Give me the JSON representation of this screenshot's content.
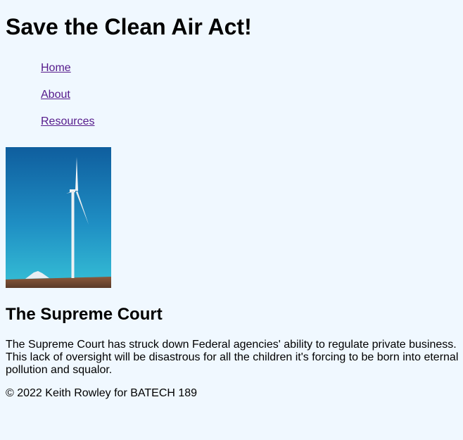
{
  "header": {
    "title": "Save the Clean Air Act!"
  },
  "nav": {
    "items": [
      {
        "label": "Home"
      },
      {
        "label": "About"
      },
      {
        "label": "Resources"
      }
    ]
  },
  "hero": {
    "subject": "wind-turbine-photo",
    "colors": {
      "sky_top": "#0f5e9e",
      "sky_bottom": "#2ab5d4",
      "ground": "#6b4a35"
    }
  },
  "main": {
    "heading": "The Supreme Court",
    "paragraph": "The Supreme Court has struck down Federal agencies' ability to regulate private business. This lack of oversight will be disastrous for all the children it's forcing to be born into eternal pollution and squalor."
  },
  "footer": {
    "text": "© 2022 Keith Rowley for BATECH 189"
  }
}
